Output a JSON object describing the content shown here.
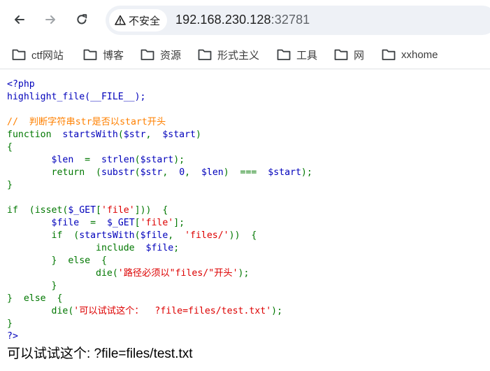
{
  "browser": {
    "security_label": "不安全",
    "url_host": "192.168.230.128",
    "url_port": ":32781"
  },
  "bookmarks": [
    {
      "label": "ctf网站",
      "icon": "folder-icon"
    },
    {
      "label": "博客",
      "icon": "folder-icon"
    },
    {
      "label": "资源",
      "icon": "folder-icon"
    },
    {
      "label": "形式主义",
      "icon": "folder-icon"
    },
    {
      "label": "工具",
      "icon": "folder-icon"
    },
    {
      "label": "网",
      "icon": "folder-icon"
    },
    {
      "label": "xxhome",
      "icon": "folder-icon"
    }
  ],
  "code_lines": [
    [
      {
        "t": "<?php",
        "c": "def"
      }
    ],
    [
      {
        "t": "highlight_file(__FILE__);",
        "c": "def"
      }
    ],
    [],
    [
      {
        "t": "//  判断字符串str是否以start开头",
        "c": "cm"
      }
    ],
    [
      {
        "t": "function  ",
        "c": "kw"
      },
      {
        "t": "startsWith",
        "c": "def"
      },
      {
        "t": "(",
        "c": "kw"
      },
      {
        "t": "$str",
        "c": "def"
      },
      {
        "t": ",  ",
        "c": "kw"
      },
      {
        "t": "$start",
        "c": "def"
      },
      {
        "t": ")",
        "c": "kw"
      }
    ],
    [
      {
        "t": "{",
        "c": "kw"
      }
    ],
    [
      {
        "t": "        ",
        "c": "kw"
      },
      {
        "t": "$len  ",
        "c": "def"
      },
      {
        "t": "=  ",
        "c": "kw"
      },
      {
        "t": "strlen",
        "c": "def"
      },
      {
        "t": "(",
        "c": "kw"
      },
      {
        "t": "$start",
        "c": "def"
      },
      {
        "t": ");",
        "c": "kw"
      }
    ],
    [
      {
        "t": "        return  ",
        "c": "kw"
      },
      {
        "t": "(",
        "c": "kw"
      },
      {
        "t": "substr",
        "c": "def"
      },
      {
        "t": "(",
        "c": "kw"
      },
      {
        "t": "$str",
        "c": "def"
      },
      {
        "t": ",  ",
        "c": "kw"
      },
      {
        "t": "0",
        "c": "def"
      },
      {
        "t": ",  ",
        "c": "kw"
      },
      {
        "t": "$len",
        "c": "def"
      },
      {
        "t": ")  ===  ",
        "c": "kw"
      },
      {
        "t": "$start",
        "c": "def"
      },
      {
        "t": ");",
        "c": "kw"
      }
    ],
    [
      {
        "t": "}",
        "c": "kw"
      }
    ],
    [],
    [
      {
        "t": "if  (isset(",
        "c": "kw"
      },
      {
        "t": "$_GET",
        "c": "def"
      },
      {
        "t": "[",
        "c": "kw"
      },
      {
        "t": "'file'",
        "c": "str"
      },
      {
        "t": "]))  {",
        "c": "kw"
      }
    ],
    [
      {
        "t": "        ",
        "c": "kw"
      },
      {
        "t": "$file  ",
        "c": "def"
      },
      {
        "t": "=  ",
        "c": "kw"
      },
      {
        "t": "$_GET",
        "c": "def"
      },
      {
        "t": "[",
        "c": "kw"
      },
      {
        "t": "'file'",
        "c": "str"
      },
      {
        "t": "];",
        "c": "kw"
      }
    ],
    [
      {
        "t": "        if  (",
        "c": "kw"
      },
      {
        "t": "startsWith",
        "c": "def"
      },
      {
        "t": "(",
        "c": "kw"
      },
      {
        "t": "$file",
        "c": "def"
      },
      {
        "t": ",  ",
        "c": "kw"
      },
      {
        "t": "'files/'",
        "c": "str"
      },
      {
        "t": "))  {",
        "c": "kw"
      }
    ],
    [
      {
        "t": "                include  ",
        "c": "kw"
      },
      {
        "t": "$file",
        "c": "def"
      },
      {
        "t": ";",
        "c": "kw"
      }
    ],
    [
      {
        "t": "        }  else  {",
        "c": "kw"
      }
    ],
    [
      {
        "t": "                die(",
        "c": "kw"
      },
      {
        "t": "'路径必须以\"files/\"开头'",
        "c": "str"
      },
      {
        "t": ");",
        "c": "kw"
      }
    ],
    [
      {
        "t": "        }",
        "c": "kw"
      }
    ],
    [
      {
        "t": "}  else  {",
        "c": "kw"
      }
    ],
    [
      {
        "t": "        die(",
        "c": "kw"
      },
      {
        "t": "'可以试试这个：  ?file=files/test.txt'",
        "c": "str"
      },
      {
        "t": ");",
        "c": "kw"
      }
    ],
    [
      {
        "t": "}",
        "c": "kw"
      }
    ],
    [
      {
        "t": "?>",
        "c": "def"
      }
    ]
  ],
  "output_text": "可以试试这个: ?file=files/test.txt",
  "colors": {
    "php_default": "#0000bb",
    "php_keyword": "#007700",
    "php_string": "#dd0000",
    "php_comment": "#ff8000"
  }
}
